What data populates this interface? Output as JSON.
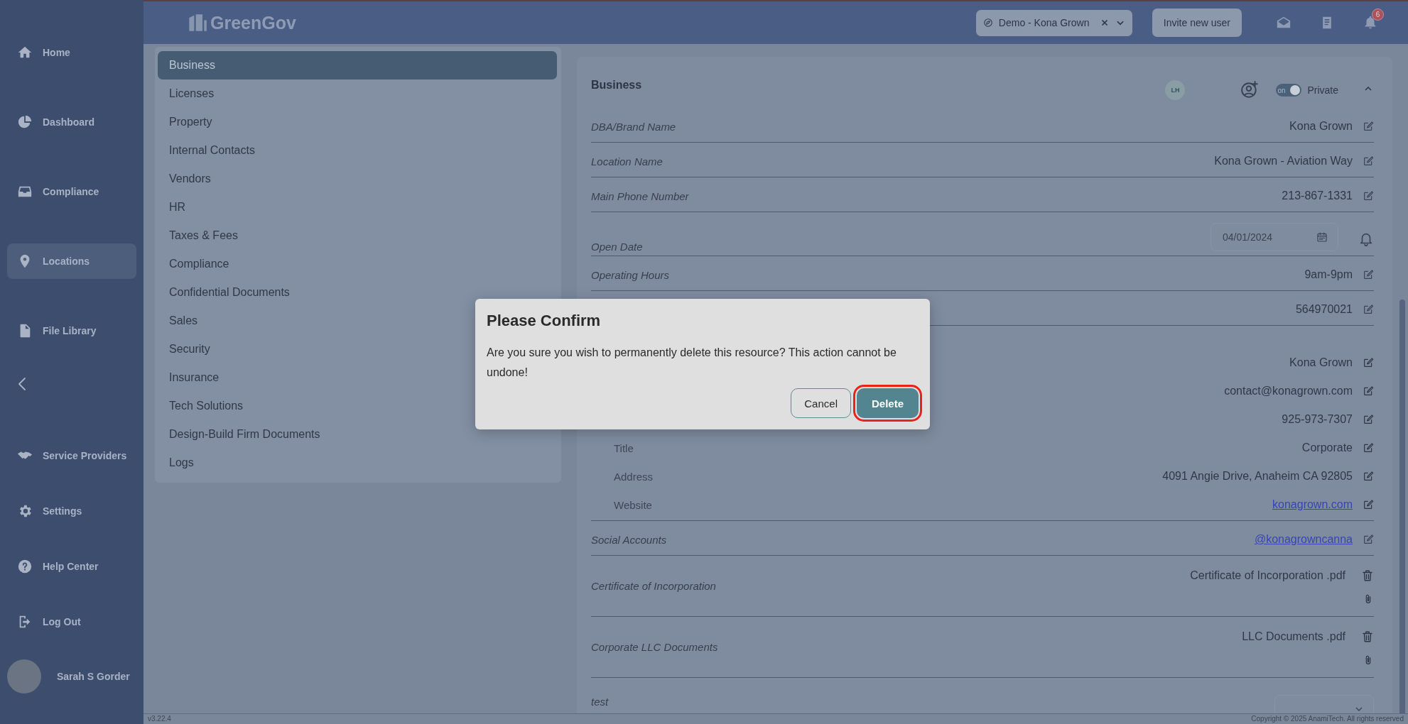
{
  "topbar": {
    "logo": "GreenGov",
    "location_select": {
      "value": "Demo - Kona Grown"
    },
    "invite_button": "Invite new user",
    "notification_count": "6"
  },
  "sidebar": {
    "main_items": [
      {
        "label": "Home",
        "selected": false
      },
      {
        "label": "Dashboard",
        "selected": false
      },
      {
        "label": "Compliance",
        "selected": false
      },
      {
        "label": "Locations",
        "selected": true
      },
      {
        "label": "File Library",
        "selected": false
      }
    ],
    "bottom_items": [
      {
        "label": "Service Providers",
        "selected": false
      },
      {
        "label": "Settings",
        "selected": false
      },
      {
        "label": "Help Center",
        "selected": false
      },
      {
        "label": "Log Out",
        "selected": false
      }
    ],
    "user": {
      "name": "Sarah S Gorder"
    }
  },
  "menu": {
    "items": [
      {
        "label": "Business",
        "selected": true
      },
      {
        "label": "Licenses",
        "selected": false
      },
      {
        "label": "Property",
        "selected": false
      },
      {
        "label": "Internal Contacts",
        "selected": false
      },
      {
        "label": "Vendors",
        "selected": false
      },
      {
        "label": "HR",
        "selected": false
      },
      {
        "label": "Taxes & Fees",
        "selected": false
      },
      {
        "label": "Compliance",
        "selected": false
      },
      {
        "label": "Confidential Documents",
        "selected": false
      },
      {
        "label": "Sales",
        "selected": false
      },
      {
        "label": "Security",
        "selected": false
      },
      {
        "label": "Insurance",
        "selected": false
      },
      {
        "label": "Tech Solutions",
        "selected": false
      },
      {
        "label": "Design-Build Firm Documents",
        "selected": false
      },
      {
        "label": "Logs",
        "selected": false
      }
    ]
  },
  "card": {
    "title": "Business",
    "avatar_initials": "LH",
    "toggle": {
      "label": "on",
      "on": true
    },
    "visibility_label": "Private",
    "expanded": true,
    "fields": [
      {
        "kind": "text",
        "label": "DBA/Brand Name",
        "value": "Kona Grown",
        "link": false
      },
      {
        "kind": "text",
        "label": "Location Name",
        "value": "Kona Grown - Aviation Way",
        "link": false
      },
      {
        "kind": "text",
        "label": "Main Phone Number",
        "value": "213-867-1331",
        "link": false
      },
      {
        "kind": "date",
        "label": "Open Date",
        "value": "04/01/2024"
      },
      {
        "kind": "text",
        "label": "Operating Hours",
        "value": "9am-9pm",
        "link": false
      },
      {
        "kind": "text",
        "value": "564970021",
        "link": false
      },
      {
        "kind": "group",
        "rows": [
          {
            "value": "Kona Grown",
            "link": false
          },
          {
            "value": "contact@konagrown.com",
            "link": false
          },
          {
            "value": "925-973-7307",
            "link": false
          },
          {
            "label": "Title",
            "value": "Corporate",
            "link": false
          },
          {
            "label": "Address",
            "value": "4091 Angie Drive, Anaheim CA 92805",
            "link": false
          },
          {
            "label": "Website",
            "value": "konagrown.com",
            "link": true
          }
        ]
      },
      {
        "kind": "text",
        "label": "Social Accounts",
        "value": "@konagrowncanna",
        "link": true
      },
      {
        "kind": "file",
        "label": "Certificate of Incorporation",
        "file": "Certificate of Incorporation .pdf"
      },
      {
        "kind": "file",
        "label": "Corporate LLC Documents",
        "file": "LLC Documents .pdf"
      },
      {
        "kind": "select",
        "label": "test"
      }
    ]
  },
  "dialog": {
    "title": "Please Confirm",
    "message": "Are you sure you wish to permanently delete this resource? This action cannot be undone!",
    "buttons": [
      {
        "label": "Cancel",
        "kind": "secondary",
        "highlighted": false
      },
      {
        "label": "Delete",
        "kind": "primary",
        "highlighted": true
      }
    ]
  },
  "footer": {
    "version": "v3.22.4",
    "copyright": "Copyright © 2025 AnamiTech. All rights reserved"
  }
}
